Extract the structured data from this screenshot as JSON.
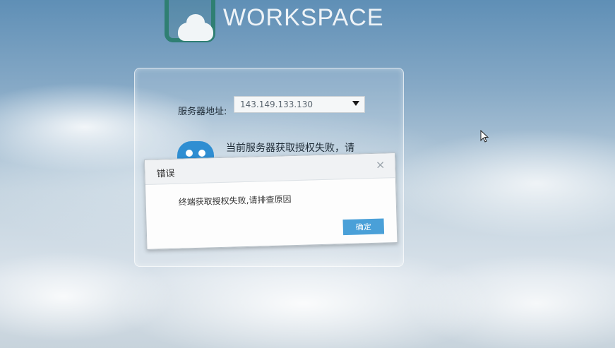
{
  "brand": {
    "text": "WORKSPACE",
    "logo": "workspace-cloud-logo"
  },
  "login_panel": {
    "server_label": "服务器地址:",
    "server_address": "143.149.133.130",
    "status_message": "当前服务器获取授权失败，请",
    "status_icon": "robot-face-icon"
  },
  "error_dialog": {
    "title": "错误",
    "message": "终端获取授权失败,请排查原因",
    "ok_label": "确定",
    "close_glyph": "×"
  },
  "colors": {
    "accent": "#4aa0d8",
    "logo": "#2f7f73",
    "status_icon": "#2f8ed2"
  }
}
